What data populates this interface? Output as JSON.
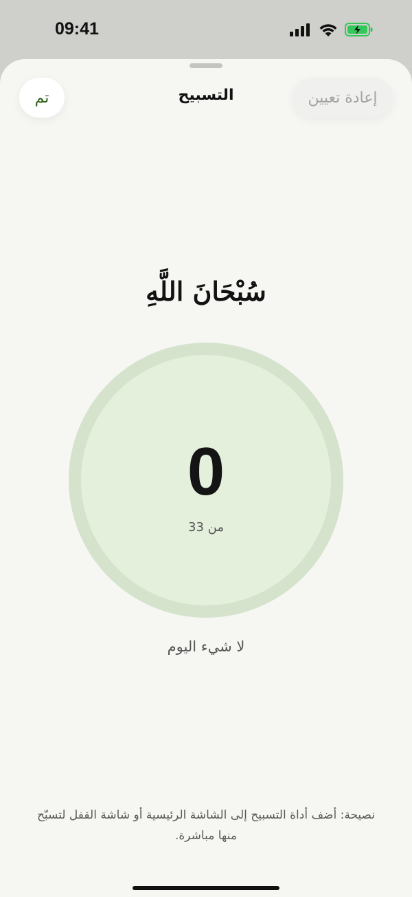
{
  "status_bar": {
    "time": "09:41",
    "signal_icon": "cellular-signal-icon",
    "wifi_icon": "wifi-icon",
    "battery_icon": "battery-charging-icon",
    "battery_color": "#34c759"
  },
  "sheet": {
    "title": "التسبيح",
    "done_label": "تم",
    "reset_label": "إعادة تعيين",
    "accent_color": "#2d5d17"
  },
  "dhikr": {
    "text": "سُبْحَانَ اللَّهِ"
  },
  "counter": {
    "value": "0",
    "target_label": "من 33",
    "ring_color": "#d5e3cd",
    "fill_color": "#e4efdc"
  },
  "today": {
    "label": "لا شيء اليوم"
  },
  "tip": {
    "text": "نصيحة: أضف أداة التسبيح إلى الشاشة الرئيسية أو شاشة القفل لتسبّح منها مباشرة."
  }
}
